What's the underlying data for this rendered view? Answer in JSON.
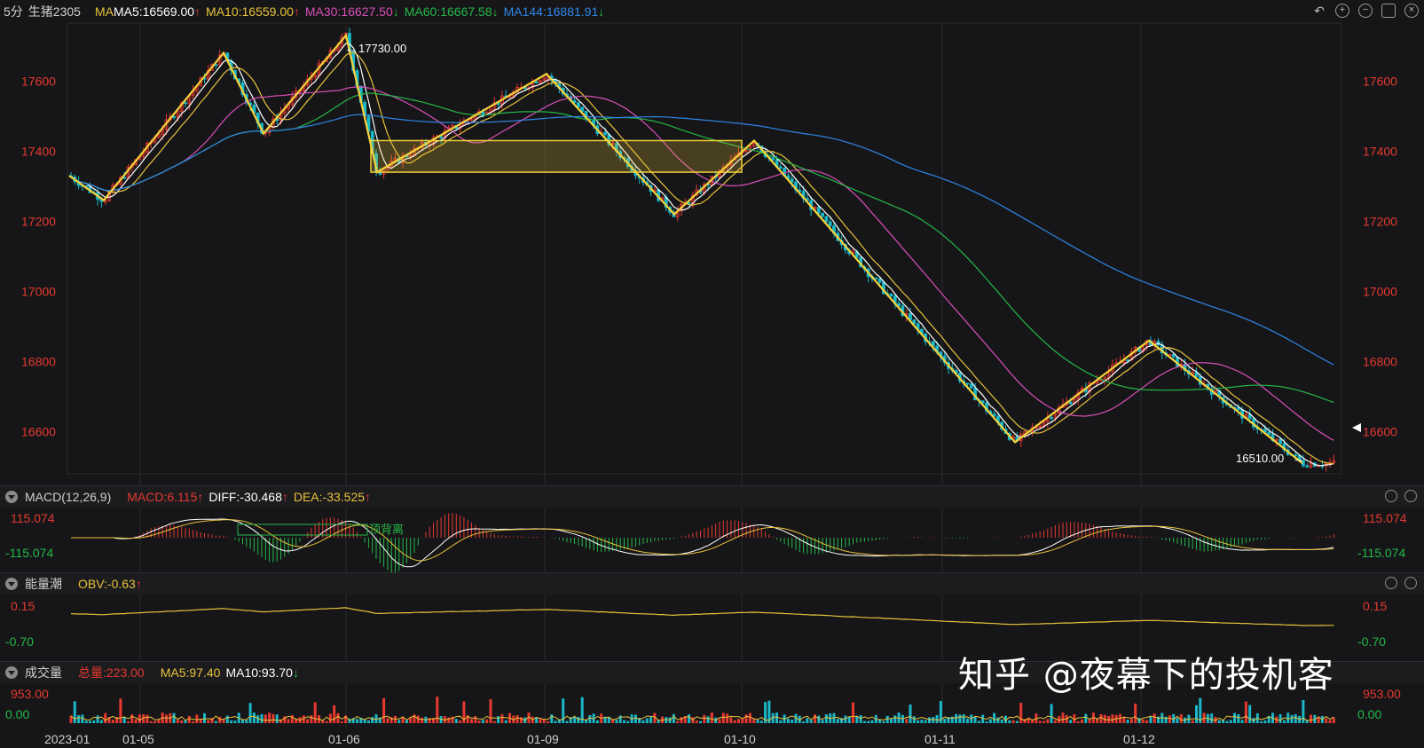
{
  "header": {
    "period": "5分",
    "symbol": "生猪2305",
    "ma_prefix": "MA",
    "ma5": "MA5:16569.00",
    "ma10": "MA10:16559.00",
    "ma30": "MA30:16627.50",
    "ma60": "MA60:16667.58",
    "ma144": "MA144:16881.91",
    "arrow_up": "↑",
    "arrow_down": "↓"
  },
  "colors": {
    "up": "#e5392f",
    "down": "#19b7c8",
    "ma5": "#ffffff",
    "ma10": "#e8c23a",
    "ma30": "#d94fb9",
    "ma60": "#25b847",
    "ma144": "#2e86e6",
    "pattern": "#f5d33c",
    "axis_red": "#e5392f"
  },
  "price_axis": {
    "ticks": [
      "17600",
      "17400",
      "17200",
      "17000",
      "16800",
      "16600"
    ]
  },
  "annotations": {
    "high": "17730.00",
    "low": "16510.00",
    "divergence": "顶背离"
  },
  "macd": {
    "title": "MACD(12,26,9)",
    "macd": "MACD:6.115",
    "diff": "DIFF:-30.468",
    "dea": "DEA:-33.525",
    "top": "115.074",
    "bottom": "-115.074"
  },
  "obv": {
    "title": "能量潮",
    "obv": "OBV:-0.63",
    "top": "0.15",
    "bottom": "-0.70"
  },
  "volume": {
    "title": "成交量",
    "total": "总量:223.00",
    "ma5": "MA5:97.40",
    "ma10": "MA10:93.70",
    "top": "953.00",
    "bottom": "0.00"
  },
  "x_axis": {
    "labels": [
      "2023-01",
      "01-05",
      "01-06",
      "01-09",
      "01-10",
      "01-11",
      "01-12"
    ]
  },
  "watermark": "知乎 @夜幕下的投机客",
  "chart_data": {
    "type": "candlestick",
    "ylim": [
      16480,
      17760
    ],
    "x_sessions": [
      "2023-01",
      "01-05",
      "01-06",
      "01-09",
      "01-10",
      "01-11",
      "01-12"
    ],
    "zigzag_pattern": [
      17330,
      17260,
      17680,
      17450,
      17730,
      17340,
      17620,
      17220,
      17430,
      16570,
      16860,
      16510
    ],
    "consolidation_box": [
      17340,
      17430
    ],
    "ma5_last": 16569.0,
    "ma10_last": 16559.0,
    "ma30_last": 16627.5,
    "ma60_last": 16667.58,
    "ma144_last": 16881.91,
    "high_marked": 17730.0,
    "low_marked": 16510.0
  }
}
